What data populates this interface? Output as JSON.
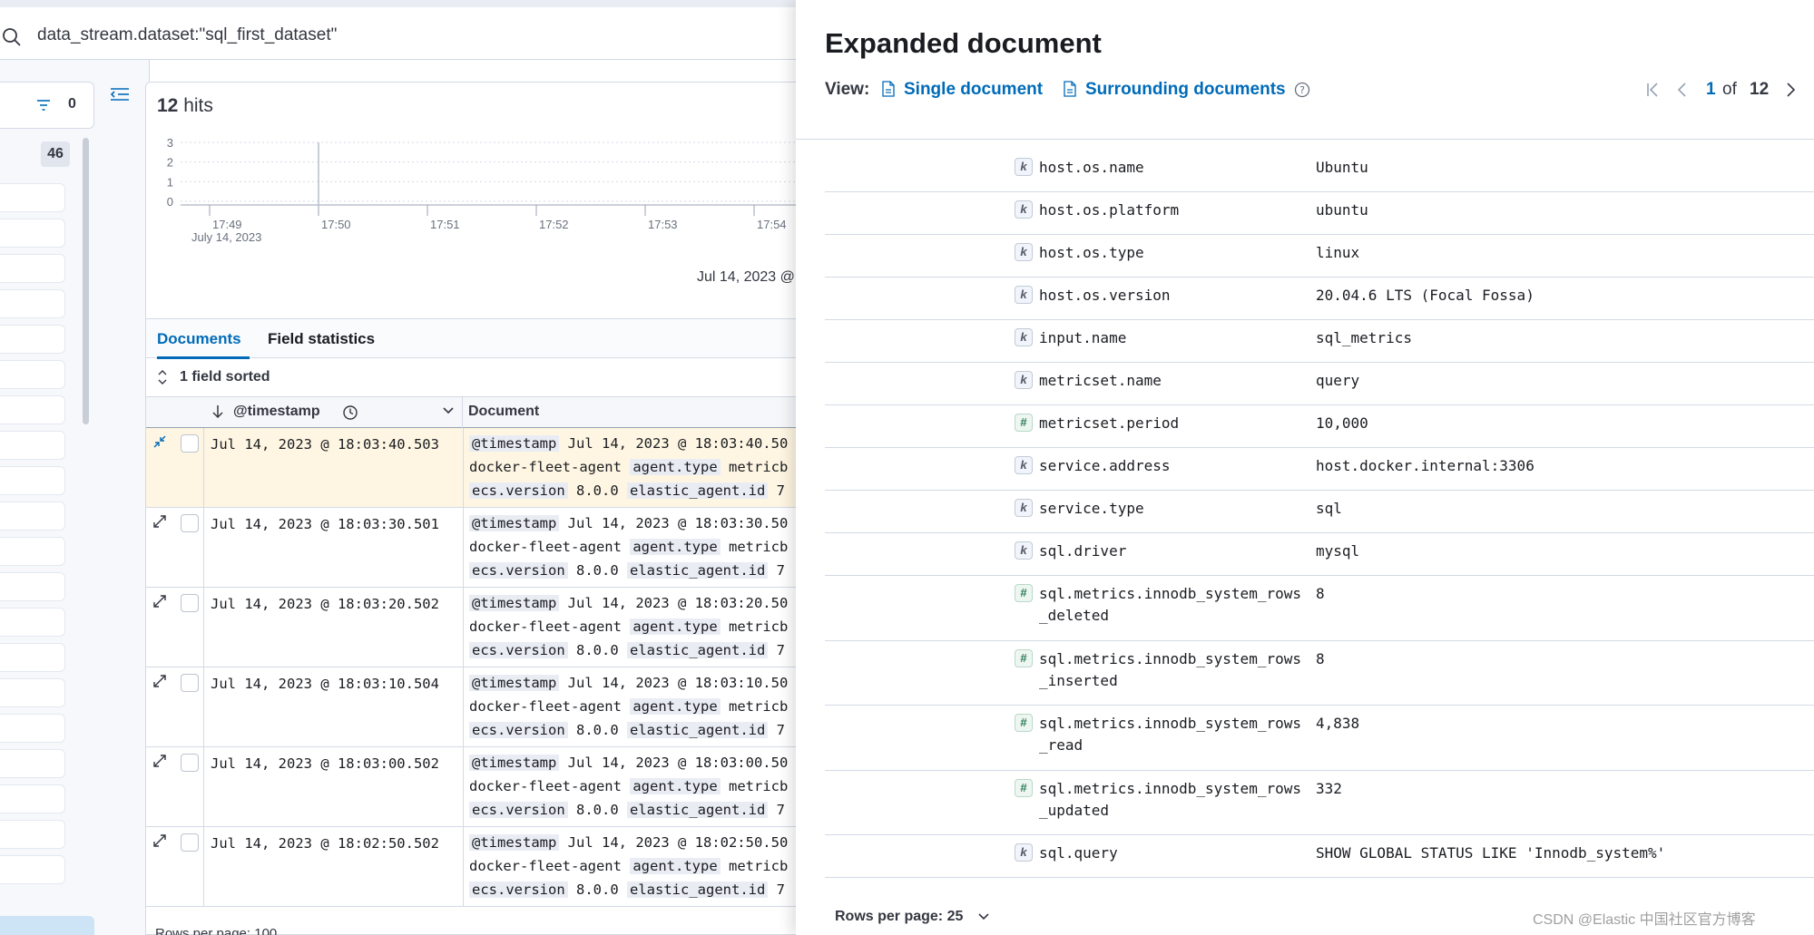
{
  "search": {
    "query": "data_stream.dataset:\"sql_first_dataset\""
  },
  "sidebar": {
    "filter_count": "0",
    "field_count": "46"
  },
  "main": {
    "hits_count": "12",
    "hits_label": "hits",
    "chart_date_label": "Jul 14, 2023 @",
    "tabs": [
      {
        "label": "Documents"
      },
      {
        "label": "Field statistics"
      }
    ],
    "sort_label": "1 field sorted",
    "columns": {
      "timestamp": "@timestamp",
      "document": "Document"
    },
    "rows": [
      {
        "timestamp": "Jul 14, 2023 @ 18:03:40.503",
        "doc_ts": "Jul 14, 2023 @ 18:03:40.50"
      },
      {
        "timestamp": "Jul 14, 2023 @ 18:03:30.501",
        "doc_ts": "Jul 14, 2023 @ 18:03:30.50"
      },
      {
        "timestamp": "Jul 14, 2023 @ 18:03:20.502",
        "doc_ts": "Jul 14, 2023 @ 18:03:20.50"
      },
      {
        "timestamp": "Jul 14, 2023 @ 18:03:10.504",
        "doc_ts": "Jul 14, 2023 @ 18:03:10.50"
      },
      {
        "timestamp": "Jul 14, 2023 @ 18:03:00.502",
        "doc_ts": "Jul 14, 2023 @ 18:03:00.50"
      },
      {
        "timestamp": "Jul 14, 2023 @ 18:02:50.502",
        "doc_ts": "Jul 14, 2023 @ 18:02:50.50"
      }
    ],
    "doc_tokens": {
      "ts_key": "@timestamp",
      "agent_name": "docker-fleet-agent",
      "agent_type_key": "agent.type",
      "agent_type_val": "metricb",
      "ecs_key": "ecs.version",
      "ecs_val": "8.0.0",
      "elastic_key": "elastic_agent.id",
      "elastic_val": "7"
    },
    "rows_per_page": "Rows per page: 100"
  },
  "chart_data": {
    "type": "bar",
    "x_tick_labels": [
      "17:49",
      "17:50",
      "17:51",
      "17:52",
      "17:53",
      "17:54"
    ],
    "x_sublabel": "July 14, 2023",
    "y_ticks": [
      "0",
      "1",
      "2",
      "3"
    ],
    "ylim": [
      0,
      3
    ],
    "grid": true,
    "colors": {
      "axis": "#98a2b3",
      "grid": "#d3dae6",
      "marker": "#b8bec8",
      "text": "#69707d"
    }
  },
  "flyout": {
    "title": "Expanded document",
    "view_label": "View:",
    "single_doc": "Single document",
    "surrounding_docs": "Surrounding documents",
    "pager": {
      "current": "1",
      "of": "of",
      "total": "12"
    },
    "fields": [
      {
        "type": "k",
        "name": "host.os.name",
        "value": "Ubuntu"
      },
      {
        "type": "k",
        "name": "host.os.platform",
        "value": "ubuntu"
      },
      {
        "type": "k",
        "name": "host.os.type",
        "value": "linux"
      },
      {
        "type": "k",
        "name": "host.os.version",
        "value": "20.04.6 LTS (Focal Fossa)"
      },
      {
        "type": "k",
        "name": "input.name",
        "value": "sql_metrics"
      },
      {
        "type": "k",
        "name": "metricset.name",
        "value": "query"
      },
      {
        "type": "#",
        "name": "metricset.period",
        "value": "10,000"
      },
      {
        "type": "k",
        "name": "service.address",
        "value": "host.docker.internal:3306"
      },
      {
        "type": "k",
        "name": "service.type",
        "value": "sql"
      },
      {
        "type": "k",
        "name": "sql.driver",
        "value": "mysql"
      },
      {
        "type": "#",
        "name": "sql.metrics.innodb_system_rows_deleted",
        "value": "8"
      },
      {
        "type": "#",
        "name": "sql.metrics.innodb_system_rows_inserted",
        "value": "8"
      },
      {
        "type": "#",
        "name": "sql.metrics.innodb_system_rows_read",
        "value": "4,838"
      },
      {
        "type": "#",
        "name": "sql.metrics.innodb_system_rows_updated",
        "value": "332"
      },
      {
        "type": "k",
        "name": "sql.query",
        "value": "SHOW GLOBAL STATUS LIKE 'Innodb_system%'"
      }
    ],
    "rows_per_page": "Rows per page: 25",
    "watermark": "CSDN @Elastic 中国社区官方博客"
  },
  "colors": {
    "accent": "#006bb8",
    "highlight_row": "#fef6e2",
    "border": "#d3dae6"
  }
}
